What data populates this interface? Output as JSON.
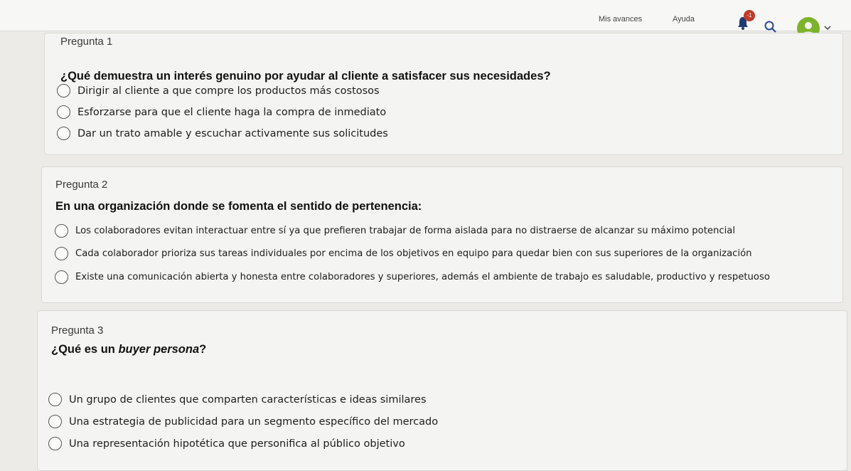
{
  "header": {
    "progress_label": "Mis avances",
    "help_label": "Ayuda",
    "notification_count": "-1"
  },
  "questions": [
    {
      "label": "Pregunta 1",
      "text": "¿Qué demuestra un interés genuino por ayudar al cliente a satisfacer sus necesidades?",
      "options": [
        "Dirigir al cliente a que compre los productos más costosos",
        "Esforzarse para que el cliente haga la compra de inmediato",
        "Dar un trato amable y escuchar activamente sus solicitudes"
      ]
    },
    {
      "label": "Pregunta 2",
      "text": "En una organización donde se fomenta el sentido de pertenencia:",
      "options": [
        "Los colaboradores evitan interactuar entre sí ya que prefieren trabajar de forma aislada para no distraerse de alcanzar su máximo potencial",
        "Cada colaborador prioriza sus tareas individuales por encima de los objetivos en equipo para quedar bien con sus superiores de la organización",
        "Existe una comunicación abierta y honesta entre colaboradores y superiores, además el ambiente de trabajo es saludable, productivo y respetuoso"
      ]
    },
    {
      "label": "Pregunta 3",
      "text_prefix": "¿Qué es un ",
      "text_emphasis": "buyer persona",
      "text_suffix": "?",
      "options": [
        "Un grupo de clientes que comparten características e ideas similares",
        "Una estrategia de publicidad para un segmento específico del mercado",
        "Una representación hipotética que personifica al público objetivo"
      ]
    }
  ]
}
